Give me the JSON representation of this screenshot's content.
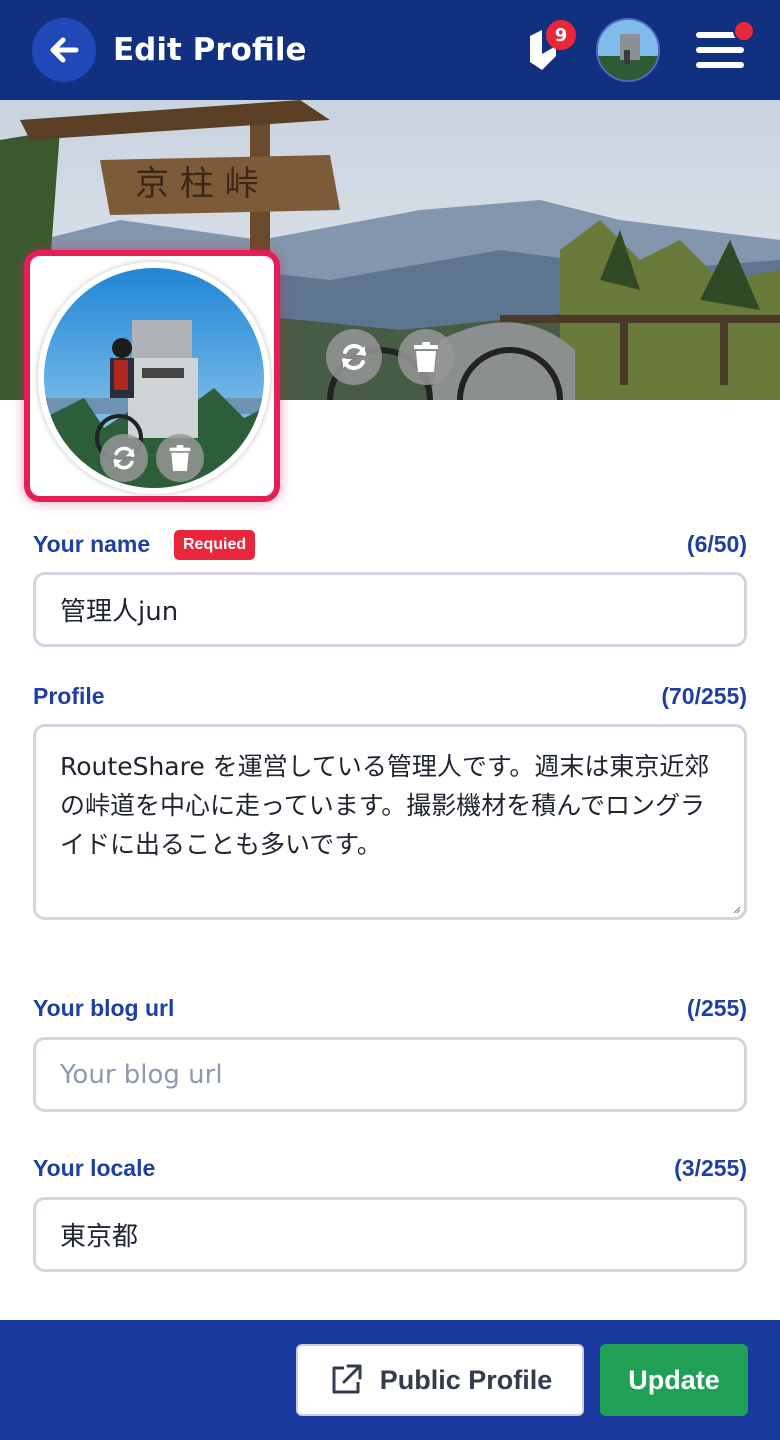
{
  "header": {
    "title": "Edit Profile",
    "notification_count": "9",
    "back_icon": "arrow-left-icon",
    "notif_icon": "bell-logo-icon",
    "menu_icon": "hamburger-menu-icon"
  },
  "cover": {
    "sign_text": "京 柱 峠",
    "actions": {
      "replace_icon": "refresh-icon",
      "delete_icon": "trash-icon"
    }
  },
  "avatar": {
    "actions": {
      "replace_icon": "refresh-icon",
      "delete_icon": "trash-icon"
    }
  },
  "form": {
    "name": {
      "label": "Your name",
      "badge": "Requied",
      "counter": "(6/50)",
      "value": "管理人jun"
    },
    "profile": {
      "label": "Profile",
      "counter": "(70/255)",
      "value": "RouteShare を運営している管理人です。週末は東京近郊の峠道を中心に走っています。撮影機材を積んでロングライドに出ることも多いです。"
    },
    "blog": {
      "label": "Your blog url",
      "counter": "(/255)",
      "placeholder": "Your blog url",
      "value": ""
    },
    "locale": {
      "label": "Your locale",
      "counter": "(3/255)",
      "value": "東京都"
    }
  },
  "footer": {
    "public_profile_label": "Public Profile",
    "update_label": "Update",
    "external_icon": "external-link-icon"
  },
  "colors": {
    "header_bg": "#11307f",
    "footer_bg": "#1a3aa0",
    "label": "#1e3fa3",
    "required": "#e9263a",
    "highlight_frame": "#e61e56",
    "update_button": "#1fa055"
  }
}
